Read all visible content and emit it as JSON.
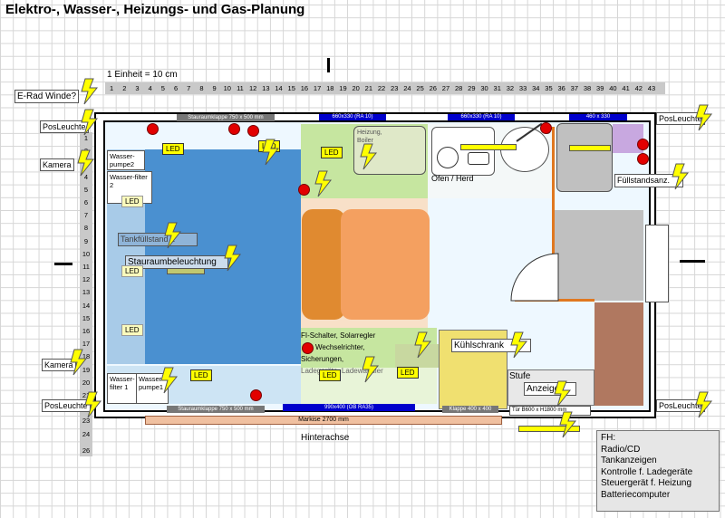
{
  "title": "Elektro-, Wasser-, Heizungs- und Gas-Planung",
  "scale_label": "1 Einheit = 10 cm",
  "ruler_top": [
    "1",
    "2",
    "3",
    "4",
    "5",
    "6",
    "7",
    "8",
    "9",
    "10",
    "11",
    "12",
    "13",
    "14",
    "15",
    "16",
    "17",
    "18",
    "19",
    "20",
    "21",
    "22",
    "23",
    "24",
    "25",
    "26",
    "27",
    "28",
    "29",
    "30",
    "31",
    "32",
    "33",
    "34",
    "35",
    "36",
    "37",
    "38",
    "39",
    "40",
    "41",
    "42",
    "43"
  ],
  "ruler_left": [
    "1",
    "2",
    "3",
    "4",
    "5",
    "6",
    "7",
    "8",
    "9",
    "10",
    "11",
    "12",
    "13",
    "14",
    "15",
    "16",
    "17",
    "18",
    "19",
    "20",
    "21",
    "22",
    "23",
    "24",
    "25"
  ],
  "ruler_left_extra": "26",
  "side_labels": {
    "erad": "E-Rad Winde?",
    "pos_tl": "PosLeuchte",
    "cam_top": "Kamera",
    "cam_bottom": "Kamera",
    "pos_bl": "PosLeuchte",
    "pos_tr": "PosLeuchte",
    "pos_br": "PosLeuchte"
  },
  "windows": {
    "top_stauraum": "Stauraumklappe 750 x 500 mm",
    "top_w1": "660x330 (RA 10)",
    "top_w2": "660x330 (RA 10)",
    "top_w3": "460 x 330",
    "bottom_stauraum": "Stauraumklappe 750 x 500 mm",
    "bottom_w": "990x400 (OB RA35)",
    "bottom_klappe": "Klappe 400 x 400",
    "bottom_door": "Tür  B600 x H1800 mm"
  },
  "markise": "Markise 2700 mm",
  "hinterachse": "Hinterachse",
  "rooms": {
    "wasserpumpe2": "Wasser-pumpe2",
    "wasserfilter2": "Wasser-filter 2",
    "tankfuellstand": "Tankfüllstand 1",
    "stauraumbeleuchtung": "Stauraumbeleuchtung",
    "heizung": "Heizung, Boiler",
    "ofen": "Ofen / Herd",
    "fuellstand": "Füllstandsanz.",
    "fi_lines": [
      "FI-Schalter, Solarregler",
      "Wechselrichter,",
      "Sicherungen,",
      "Ladegeräte, Ladewandler"
    ],
    "kuehlschrank": "Kühlschrank",
    "stufe": "Stufe",
    "anzeige": "Anzeige",
    "wasserfilter1": "Wasser-filter 1",
    "wasserpumpe1": "Wasser-pumpe1"
  },
  "led_label": "LED",
  "fh": {
    "lines": [
      "FH:",
      "Radio/CD",
      "Tankanzeigen",
      "Kontrolle f. Ladegeräte",
      "Steuergerät f. Heizung",
      "Batteriecomputer"
    ]
  },
  "colors": {
    "blue_area": "#4a90d0",
    "green_area": "#c6e6a0",
    "orange_bed": "#f4a060",
    "grey_area": "#c0c0c0",
    "yellow_box": "#f0e070",
    "brown": "#b07860"
  }
}
